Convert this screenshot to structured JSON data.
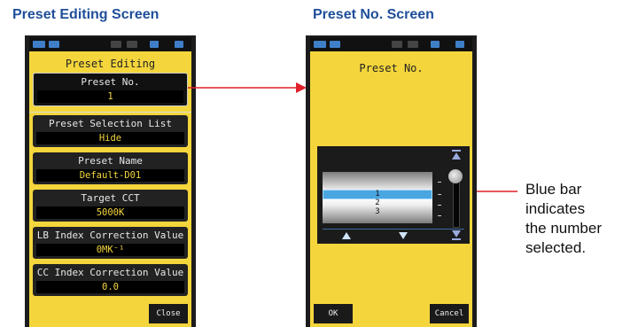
{
  "captions": {
    "left": "Preset Editing Screen",
    "right": "Preset No. Screen"
  },
  "editing": {
    "title": "Preset Editing",
    "items": [
      {
        "label": "Preset No.",
        "value": "1"
      },
      {
        "label": "Preset Selection List",
        "value": "Hide"
      },
      {
        "label": "Preset Name",
        "value": "Default-D01"
      },
      {
        "label": "Target CCT",
        "value": "5000K"
      },
      {
        "label": "LB Index Correction Value",
        "value": "0MK⁻¹"
      },
      {
        "label": "CC Index Correction Value",
        "value": "0.0"
      }
    ],
    "close_label": "Close"
  },
  "preset_no": {
    "title": "Preset No.",
    "wheel_values": [
      "1",
      "2",
      "3"
    ],
    "selected_value": "1",
    "ok_label": "OK",
    "cancel_label": "Cancel"
  },
  "annotation": {
    "lines": [
      "Blue bar",
      "indicates",
      "the number",
      "selected."
    ]
  },
  "colors": {
    "caption": "#1f4e9a",
    "screen_bg": "#f4d63c",
    "connector": "#e0202a",
    "selection": "#4aa6e0"
  },
  "icons": [
    "battery-icon",
    "bluetooth-icon",
    "up-arrow-icon",
    "down-arrow-icon",
    "scroll-top-icon",
    "scroll-bottom-icon"
  ]
}
